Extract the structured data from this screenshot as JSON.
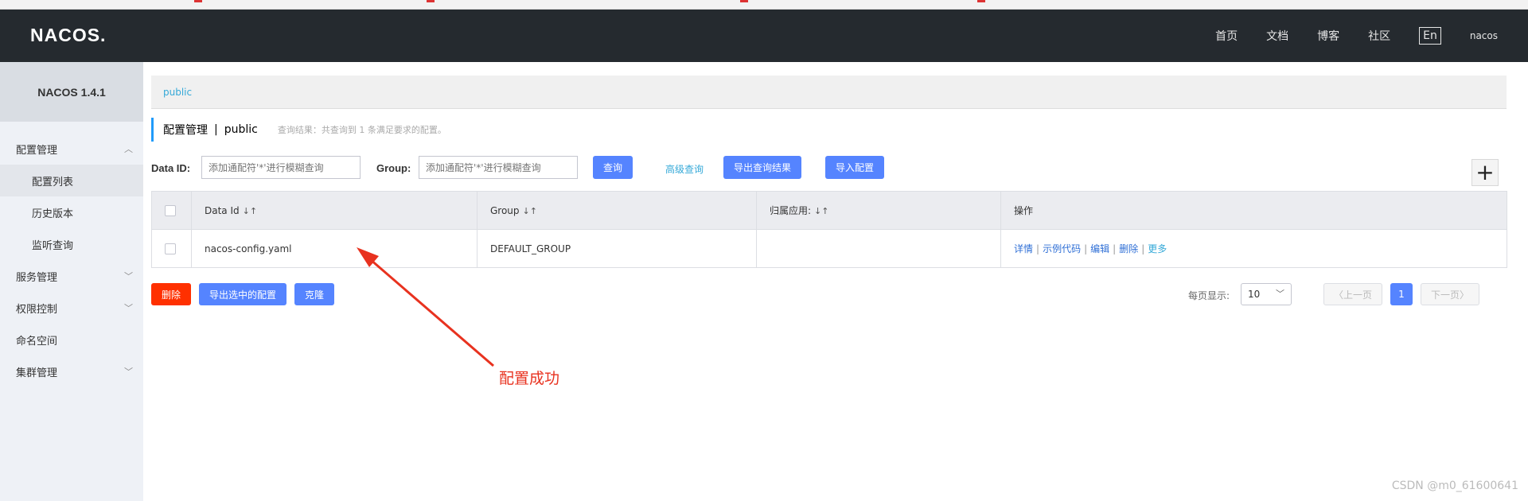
{
  "header": {
    "logo": "NACOS.",
    "nav": [
      "首页",
      "文档",
      "博客",
      "社区"
    ],
    "lang": "En",
    "user": "nacos"
  },
  "sidebar": {
    "version": "NACOS 1.4.1",
    "groups": [
      {
        "label": "配置管理",
        "expanded": true,
        "items": [
          "配置列表",
          "历史版本",
          "监听查询"
        ]
      },
      {
        "label": "服务管理",
        "expanded": false
      },
      {
        "label": "权限控制",
        "expanded": false
      },
      {
        "label": "命名空间",
        "expanded": false
      },
      {
        "label": "集群管理",
        "expanded": false
      }
    ]
  },
  "breadcrumb": "public",
  "title": {
    "main": "配置管理",
    "separator": "|",
    "namespace": "public",
    "hint": "查询结果：共查询到 1 条满足要求的配置。"
  },
  "filters": {
    "dataid_label": "Data ID:",
    "dataid_placeholder": "添加通配符'*'进行模糊查询",
    "group_label": "Group:",
    "group_placeholder": "添加通配符'*'进行模糊查询",
    "query_button": "查询",
    "advanced_link": "高级查询",
    "export_button": "导出查询结果",
    "import_button": "导入配置",
    "add_button": "+"
  },
  "table": {
    "headers": [
      "Data Id",
      "Group",
      "归属应用:",
      "操作"
    ],
    "rows": [
      {
        "data_id": "nacos-config.yaml",
        "group": "DEFAULT_GROUP",
        "app": "",
        "ops": [
          "详情",
          "示例代码",
          "编辑",
          "删除",
          "更多"
        ]
      }
    ]
  },
  "bulk_actions": {
    "delete": "删除",
    "export_selected": "导出选中的配置",
    "clone": "克隆"
  },
  "pagination": {
    "page_size_label": "每页显示:",
    "page_size": "10",
    "prev": "上一页",
    "current": "1",
    "next": "下一页"
  },
  "annotation": "配置成功",
  "watermark": "CSDN @m0_61600641",
  "colors": {
    "primary": "#5584ff",
    "danger": "#ff3000",
    "link": "#35a9d8",
    "topbar": "#252a2f",
    "annotation": "#e8321f"
  }
}
